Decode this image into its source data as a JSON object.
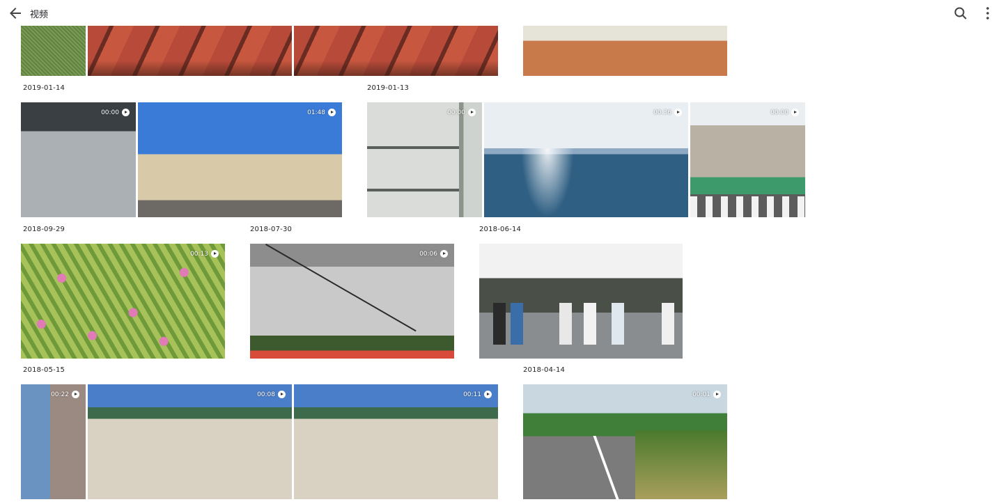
{
  "header": {
    "title": "视频"
  },
  "groups": [
    {
      "date": "2019-01-14"
    },
    {
      "date": "2019-01-13"
    },
    {
      "date": "2018-09-29"
    },
    {
      "date": "2018-07-30"
    },
    {
      "date": "2018-06-14"
    },
    {
      "date": "2018-05-15"
    },
    {
      "date": "2018-04-14"
    }
  ],
  "videos": {
    "v_0929_a": "00:00",
    "v_0730_a": "01:48",
    "v_0614_a": "00:00",
    "v_0614_b": "00:36",
    "v_0614_c": "00:00",
    "v_0515_a": "00:13",
    "v_0414_cloudy": "00:06",
    "v_row4_a": "00:22",
    "v_row4_b": "00:08",
    "v_row4_c": "00:11",
    "v_row4_d": "00:01"
  },
  "icons": {
    "back": "arrow-left-icon",
    "search": "search-icon",
    "more": "more-vertical-icon",
    "play": "play-circle-icon"
  }
}
